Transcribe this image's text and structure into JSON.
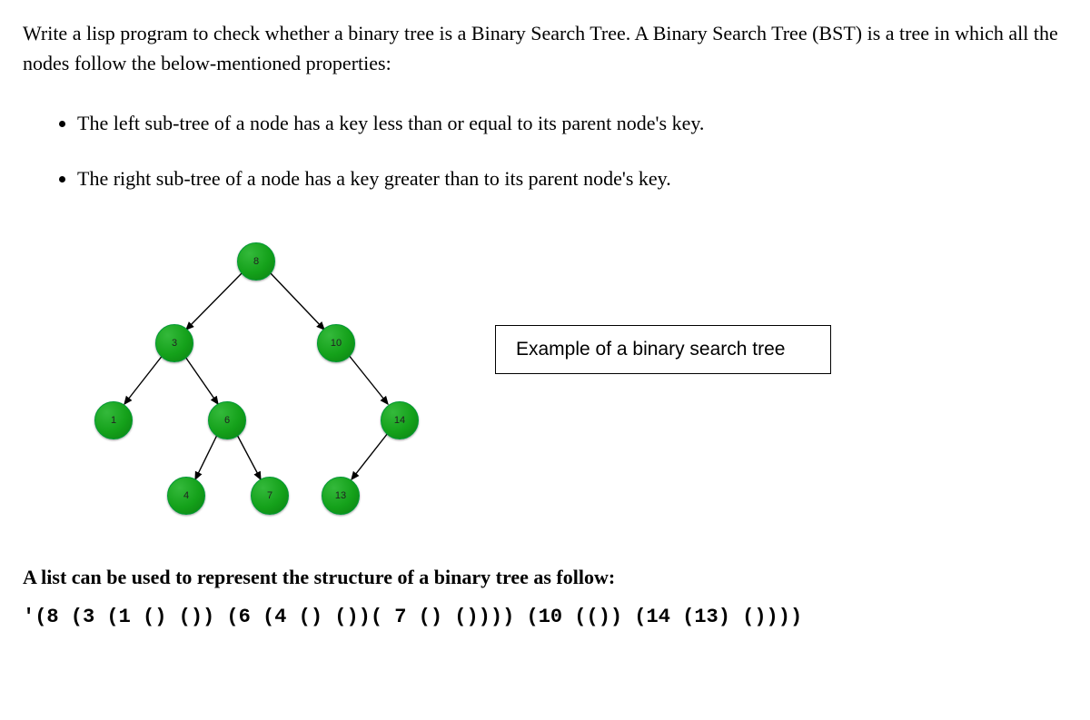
{
  "intro": "Write a lisp program to check whether a binary tree is a Binary Search Tree. A Binary Search Tree (BST) is a tree in which all the nodes follow the below-mentioned properties:",
  "props": [
    "The left sub-tree of a node has a key less than or equal to its parent node's key.",
    "The right sub-tree of a node has a key greater than to its parent node's key."
  ],
  "caption": "Example of a binary search tree",
  "tree": {
    "nodes": {
      "n8": "8",
      "n3": "3",
      "n10": "10",
      "n1": "1",
      "n6": "6",
      "n14": "14",
      "n4": "4",
      "n7": "7",
      "n13": "13"
    }
  },
  "chart_data": {
    "type": "tree",
    "root": {
      "value": 8,
      "left": {
        "value": 3,
        "left": {
          "value": 1,
          "left": null,
          "right": null
        },
        "right": {
          "value": 6,
          "left": {
            "value": 4,
            "left": null,
            "right": null
          },
          "right": {
            "value": 7,
            "left": null,
            "right": null
          }
        }
      },
      "right": {
        "value": 10,
        "left": null,
        "right": {
          "value": 14,
          "left": {
            "value": 13,
            "left": null,
            "right": null
          },
          "right": null
        }
      }
    }
  },
  "list_rep_label": "A list can be used to represent the structure of a binary tree as follow:",
  "code": "'(8 (3 (1 () ()) (6 (4 () ())( 7 () ()))) (10 (()) (14 (13) ())))"
}
